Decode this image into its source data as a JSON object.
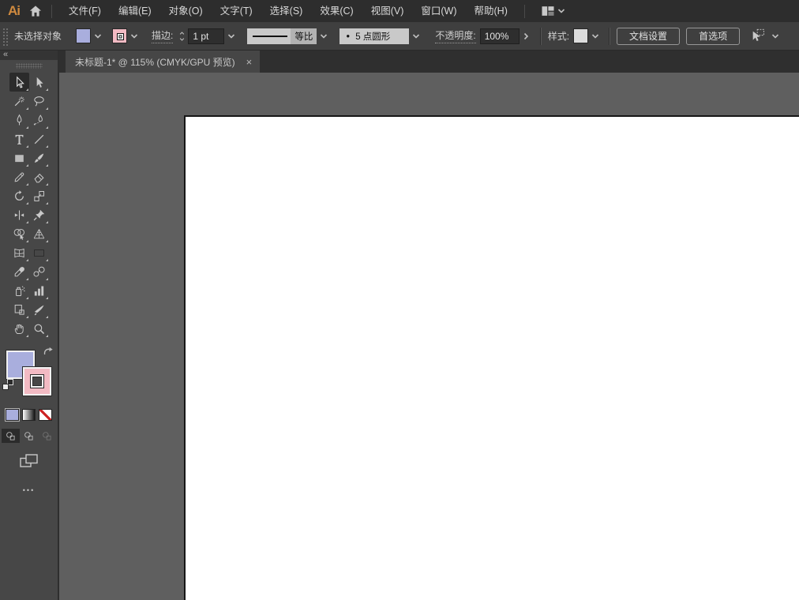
{
  "menu_bar": {
    "logo": "Ai",
    "items": [
      {
        "label": "文件(F)"
      },
      {
        "label": "编辑(E)"
      },
      {
        "label": "对象(O)"
      },
      {
        "label": "文字(T)"
      },
      {
        "label": "选择(S)"
      },
      {
        "label": "效果(C)"
      },
      {
        "label": "视图(V)"
      },
      {
        "label": "窗口(W)"
      },
      {
        "label": "帮助(H)"
      }
    ]
  },
  "control_bar": {
    "selection_status": "未选择对象",
    "fill_swatch_color": "#a9aedd",
    "stroke_swatch_color": "#f2bac3",
    "stroke_label": "描边:",
    "stroke_weight_value": "1 pt",
    "stroke_profile_label": "等比",
    "brush_bullet": "●",
    "brush_name": "5 点圆形",
    "opacity_label": "不透明度:",
    "opacity_value": "100%",
    "style_label": "样式:",
    "document_setup_label": "文档设置",
    "preferences_label": "首选项"
  },
  "document_tab": {
    "title": "未标题-1* @ 115% (CMYK/GPU 预览)",
    "close_glyph": "×"
  },
  "toolbar": {
    "collapse_glyph": "«",
    "selected_tool": "selection",
    "tools": [
      "selection",
      "direct-selection",
      "magic-wand",
      "lasso",
      "pen",
      "curvature",
      "type",
      "line-segment",
      "rectangle",
      "paintbrush",
      "pencil",
      "eraser",
      "rotate",
      "scale",
      "width",
      "puppet-warp",
      "shape-builder",
      "perspective-grid",
      "mesh",
      "gradient",
      "eyedropper",
      "blend",
      "symbol-sprayer",
      "column-graph",
      "artboard",
      "slice",
      "hand",
      "zoom"
    ],
    "fill_color": "#a9aedd",
    "stroke_color": "#f2bac3",
    "ellipsis_glyph": "•••"
  },
  "canvas": {
    "background_color": "#5f5f5f",
    "artboard_color": "#ffffff"
  }
}
